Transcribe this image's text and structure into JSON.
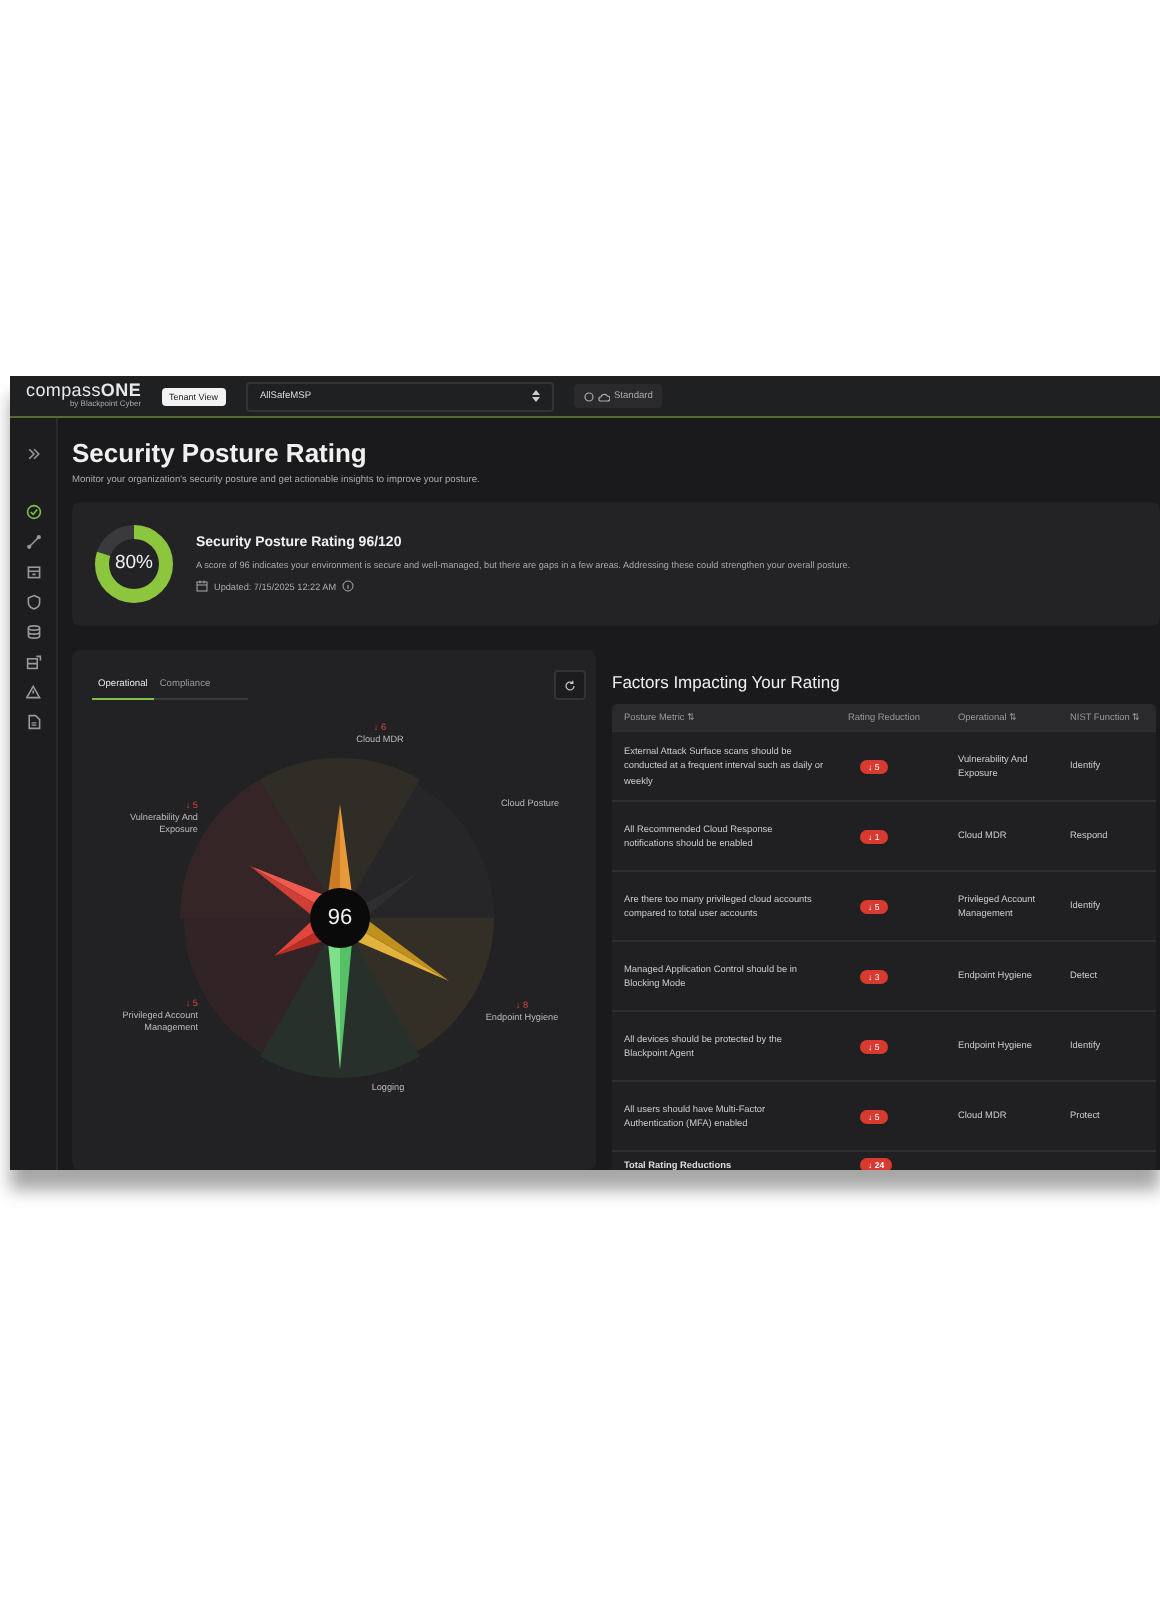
{
  "topbar": {
    "logo": "compass**ONE**",
    "logo_sub": "by Blackpoint Cyber",
    "view_button": "Tenant View",
    "tenant_select": "AllSafeMSP",
    "plan_chip": "Standard"
  },
  "sidebar": {
    "items": [
      {
        "kind": "collapse",
        "selected": false
      },
      {
        "kind": "check",
        "selected": true
      },
      {
        "kind": "network",
        "selected": false
      },
      {
        "kind": "building",
        "selected": false
      },
      {
        "kind": "shield",
        "selected": false
      },
      {
        "kind": "database",
        "selected": false
      },
      {
        "kind": "stack",
        "selected": false
      },
      {
        "kind": "alert",
        "selected": false
      },
      {
        "kind": "document",
        "selected": false
      }
    ]
  },
  "page": {
    "title": "Security Posture Rating",
    "subtitle": "Monitor your organization's security posture and get actionable insights to improve your posture."
  },
  "summary": {
    "percent": "80%",
    "level": 0.8,
    "title": "Security Posture Rating 96/120",
    "description": "A score of 96 indicates your environment is secure and well-managed, but there are gaps in a few areas. Addressing these could strengthen your overall posture.",
    "updated": "Updated: 7/15/2025 12:22 AM"
  },
  "chart_panel": {
    "tabs": [
      {
        "label": "Operational",
        "selected": true
      },
      {
        "label": "Compliance",
        "selected": false
      }
    ],
    "score": "96",
    "segments": [
      {
        "label": "Cloud MDR",
        "reduction": "↓ 6"
      },
      {
        "label": "Vulnerability And Exposure",
        "reduction": "↓ 5"
      },
      {
        "label": "Cloud Posture"
      },
      {
        "label": "Privileged Account Management",
        "reduction": "↓ 5"
      },
      {
        "label": "Endpoint Hygiene",
        "reduction": "↓ 8"
      },
      {
        "label": "Logging"
      }
    ]
  },
  "factors": {
    "title": "Factors Impacting Your Rating",
    "columns": [
      "Posture Metric ⇅",
      "Rating Reduction",
      "Operational ⇅",
      "NIST Function ⇅"
    ],
    "rows": [
      {
        "metric": "External Attack Surface scans should be conducted at a frequent interval such as daily or weekly",
        "reduction": "↓ 5",
        "operational": "Vulnerability And Exposure",
        "nist": "Identify"
      },
      {
        "metric": "All Recommended Cloud Response notifications should be enabled",
        "reduction": "↓ 1",
        "operational": "Cloud MDR",
        "nist": "Respond"
      },
      {
        "metric": "Are there too many privileged cloud accounts compared to total user accounts",
        "reduction": "↓ 5",
        "operational": "Privileged Account Management",
        "nist": "Identify"
      },
      {
        "metric": "Managed Application Control should be in Blocking Mode",
        "reduction": "↓ 3",
        "operational": "Endpoint Hygiene",
        "nist": "Detect"
      },
      {
        "metric": "All devices should be protected by the Blackpoint Agent",
        "reduction": "↓ 5",
        "operational": "Endpoint Hygiene",
        "nist": "Identify"
      },
      {
        "metric": "All users should have Multi-Factor Authentication (MFA) enabled",
        "reduction": "↓ 5",
        "operational": "Cloud MDR",
        "nist": "Protect"
      }
    ],
    "total": {
      "label": "Total Rating Reductions",
      "reduction": "↓ 24"
    }
  }
}
